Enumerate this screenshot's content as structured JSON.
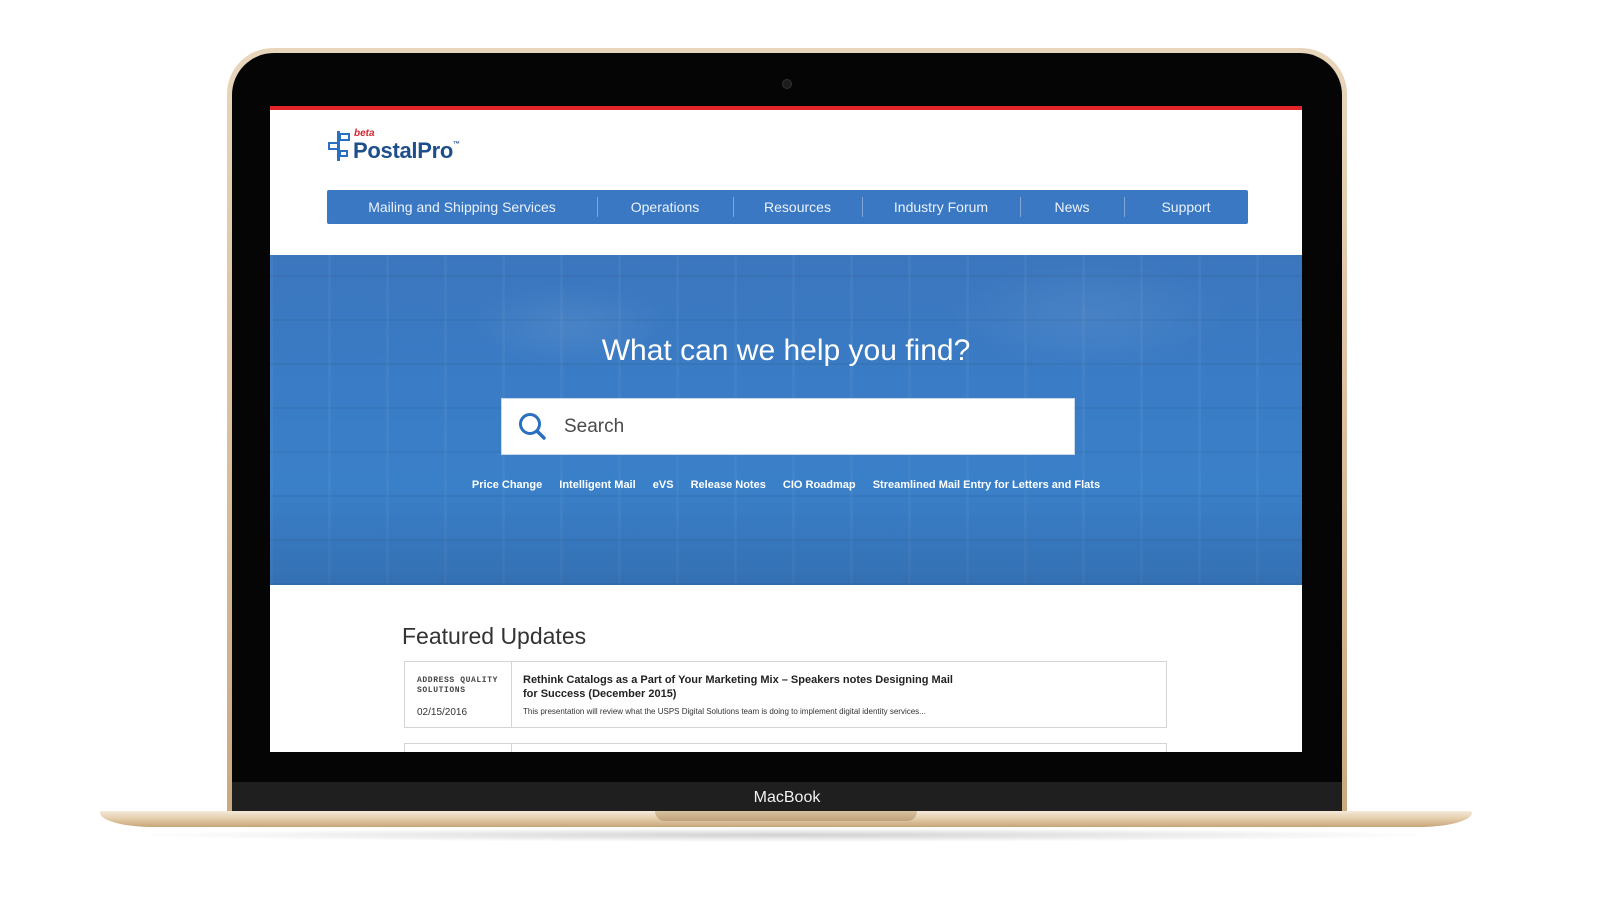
{
  "device": {
    "label": "MacBook"
  },
  "logo": {
    "beta": "beta",
    "name": "PostalPro",
    "tm": "™"
  },
  "nav": {
    "items": [
      {
        "label": "Mailing and Shipping Services"
      },
      {
        "label": "Operations"
      },
      {
        "label": "Resources"
      },
      {
        "label": "Industry Forum"
      },
      {
        "label": "News"
      },
      {
        "label": "Support"
      }
    ]
  },
  "hero": {
    "title": "What can we help you find?",
    "search_placeholder": "Search",
    "quick_links": [
      "Price Change",
      "Intelligent Mail",
      "eVS",
      "Release Notes",
      "CIO Roadmap",
      "Streamlined Mail Entry for Letters and Flats"
    ]
  },
  "featured": {
    "title": "Featured Updates",
    "items": [
      {
        "category": "ADDRESS QUALITY SOLUTIONS",
        "date": "02/15/2016",
        "title": "Rethink Catalogs as a Part of Your Marketing Mix – Speakers notes Designing Mail for Success (December 2015)",
        "description": "This presentation will review what the USPS Digital Solutions team is doing to implement digital identity services..."
      }
    ]
  },
  "colors": {
    "accent_red": "#e3242b",
    "nav_blue": "#3a78c3",
    "hero_blue": "#3a7cc6",
    "logo_blue": "#1e4e8c"
  }
}
